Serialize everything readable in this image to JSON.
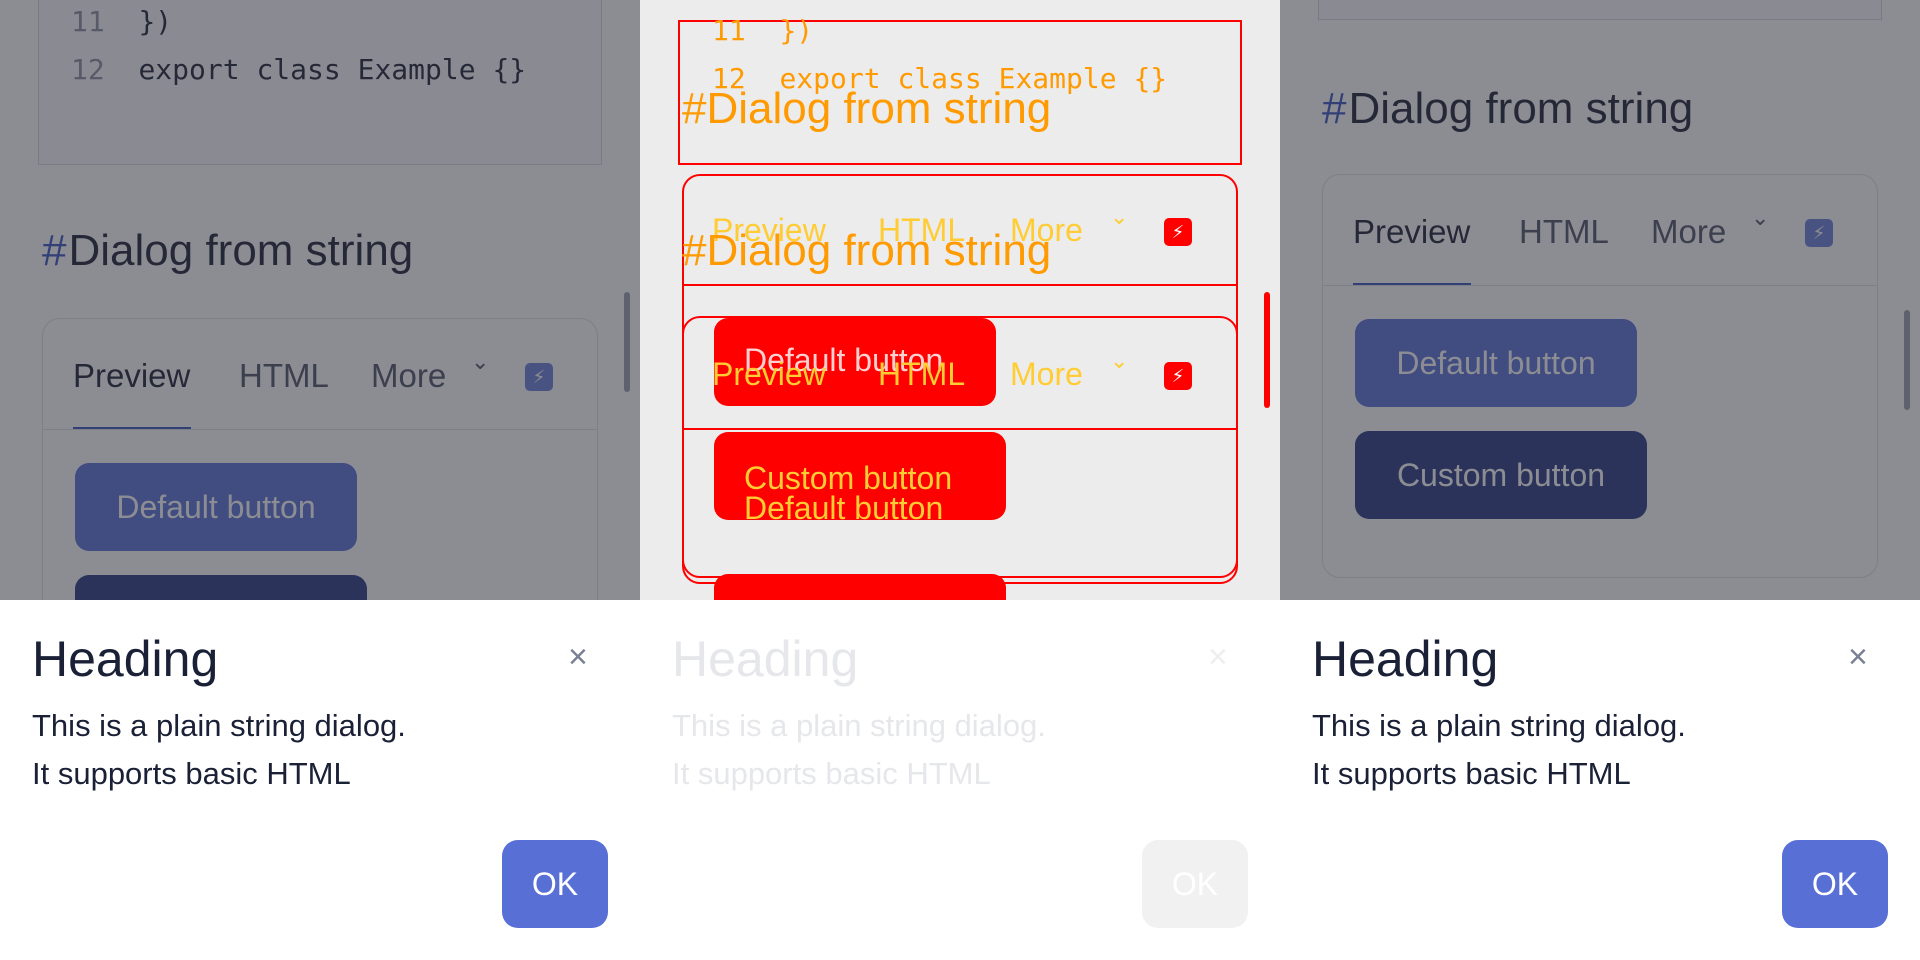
{
  "code": {
    "line11_num": "11",
    "line11_text": "})",
    "line12_num": "12",
    "line12_text": "export class Example {}"
  },
  "section": {
    "hash": "#",
    "title": "Dialog from string"
  },
  "tabs": {
    "preview": "Preview",
    "html": "HTML",
    "more": "More",
    "chevron": "⌄",
    "bolt": "⚡"
  },
  "buttons": {
    "default": "Default button",
    "custom": "Custom button"
  },
  "dialog": {
    "title": "Heading",
    "close": "×",
    "line1": "This is a plain string dialog.",
    "line2": "It supports basic HTML",
    "ok": "OK"
  }
}
